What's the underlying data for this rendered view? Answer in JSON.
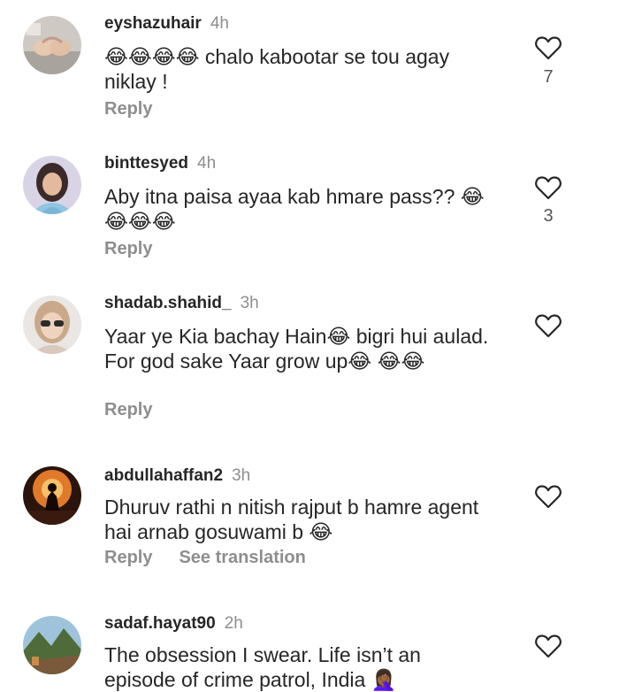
{
  "comments": [
    {
      "username": "eyshazuhair",
      "time": "4h",
      "text": "😂😂😂😂 chalo kabootar se tou agay niklay !",
      "reply": "Reply",
      "likes": "7",
      "avatar_icon": "hands-heart-avatar"
    },
    {
      "username": "binttesyed",
      "time": "4h",
      "text": "Aby itna paisa ayaa kab hmare pass?? 😂😂😂😂",
      "reply": "Reply",
      "likes": "3",
      "avatar_icon": "woman-portrait-avatar"
    },
    {
      "username": "shadab.shahid_",
      "time": "3h",
      "text": "Yaar ye Kia bachay Hain😂 bigri hui aulad. For god sake Yaar grow up😂 😂😂",
      "reply": "Reply",
      "likes": "",
      "avatar_icon": "woman-sunglasses-avatar"
    },
    {
      "username": "abdullahaffan2",
      "time": "3h",
      "text": "Dhuruv rathi n nitish rajput b hamre agent hai arnab gosuwami b 😂",
      "reply": "Reply",
      "see_translation": "See translation",
      "likes": "",
      "avatar_icon": "silhouette-fire-avatar"
    },
    {
      "username": "sadaf.hayat90",
      "time": "2h",
      "text": "The obsession I swear. Life isn’t an episode of crime patrol, India 🤦🏾‍♀️",
      "reply": "",
      "likes": "",
      "avatar_icon": "landscape-avatar"
    }
  ],
  "colors": {
    "text": "#262626",
    "muted": "#8e8e8e",
    "like_count": "#555555",
    "background": "#ffffff"
  }
}
